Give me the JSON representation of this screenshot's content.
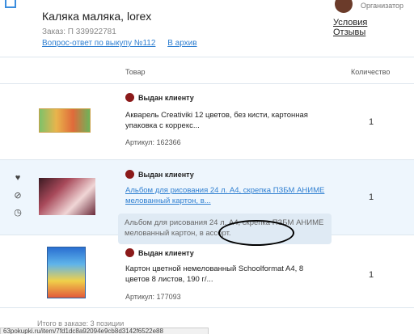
{
  "header": {
    "shop_title": "Каляка маляка, lorex",
    "order_number": "Заказ: П 339922781",
    "link_question": "Вопрос-ответ по выкупу №112",
    "link_archive": "В архив",
    "organizer_label": "Организатор",
    "link_terms": "Условия",
    "link_reviews": "Отзывы"
  },
  "table": {
    "col_product": "Товар",
    "col_quantity": "Количество"
  },
  "items": [
    {
      "status": "Выдан клиенту",
      "name": "Акварель Creativiki 12 цветов, без кисти, картонная упаковка с коррекс...",
      "article": "Артикул: 162366",
      "quantity": "1"
    },
    {
      "status": "Выдан клиенту",
      "name": "Альбом для рисования 24 л. А4, скрепка ПЗБМ АНИМЕ мелованный картон, в...",
      "note": "Альбом для рисования 24 л. А4, скрепка ПЗБМ АНИМЕ мелованный картон, в ассорт.",
      "quantity": "1",
      "side_icons": [
        "heart-icon",
        "percent-icon",
        "clock-icon"
      ]
    },
    {
      "status": "Выдан клиенту",
      "name": "Картон цветной немелованный Schoolformat A4, 8 цветов 8 листов, 190 г/...",
      "article": "Артикул: 177093",
      "quantity": "1"
    }
  ],
  "footer": {
    "total": "Итого в заказе: 3 позиции",
    "url": "63pokupki.ru/item/7fd1dc8a92094e9cb8d3142f6522e88"
  },
  "colors": {
    "link": "#2f7fd1",
    "status_dot": "#8b1a1a",
    "highlight_row": "#eef6fd",
    "note_bg": "#dfeaf4"
  }
}
